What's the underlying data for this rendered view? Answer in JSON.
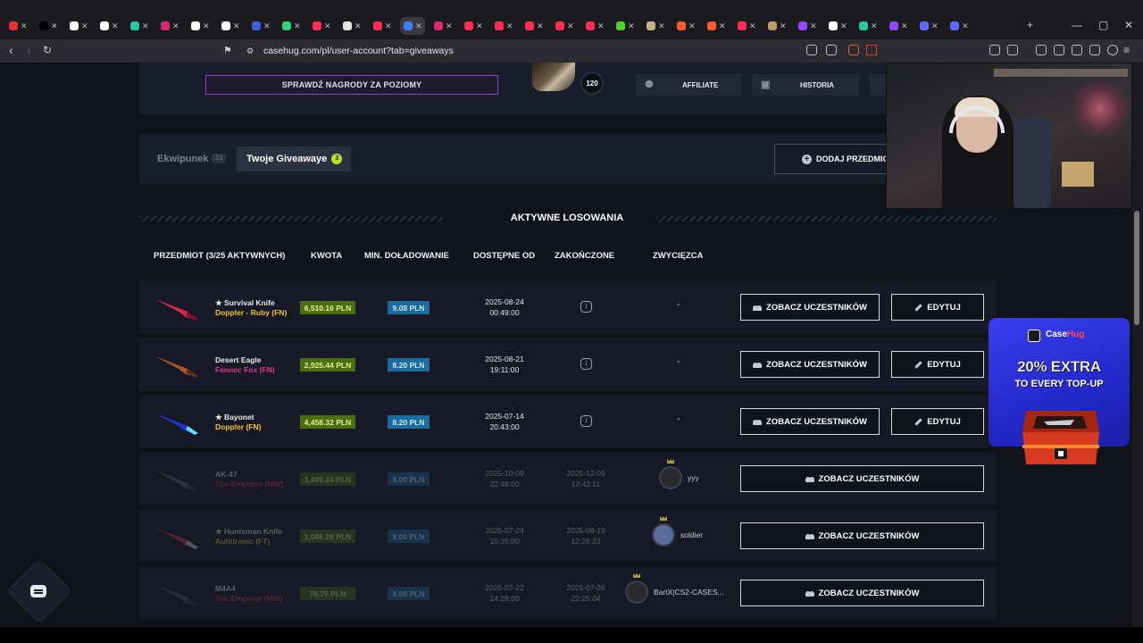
{
  "browser": {
    "url": "casehug.com/pl/user-account?tab=giveaways",
    "tab_favicon_colors": [
      "#e5323b",
      "#000000",
      "#ffffff",
      "#ffffff",
      "#27c7a0",
      "#d62976",
      "#ffffff",
      "#ffffff",
      "#3f5fd8",
      "#31d07a",
      "#ff2d55",
      "#e6e6e6",
      "#ff2d55",
      "#3f7cff",
      "#d62976",
      "#ff2d55",
      "#ff2d55",
      "#ff2d55",
      "#ff2d55",
      "#ff2d55",
      "#4cd32f",
      "#c9b48a",
      "#ff5a2d",
      "#ff5a2d",
      "#ff2d55",
      "#b89a6a",
      "#9146ff",
      "#ffffff",
      "#27c7a0",
      "#9146ff",
      "#5b6cff",
      "#5b6cff"
    ]
  },
  "header": {
    "levels_button": "SPRAWDŹ NAGRODY ZA POZIOMY",
    "level": "120",
    "affiliate": "AFFILIATE",
    "history": "HISTORIA"
  },
  "tabs": {
    "inventory": "Ekwipunek",
    "inventory_count": "23",
    "giveaways": "Twoje Giveawaye",
    "giveaways_count": "3",
    "add_item": "DODAJ PRZEDMIOT"
  },
  "section_title": "AKTYWNE LOSOWANIA",
  "table": {
    "columns": [
      "PRZEDMIOT (3/25 AKTYWNYCH)",
      "KWOTA",
      "MIN. DOŁADOWANIE",
      "DOSTĘPNE OD",
      "ZAKOŃCZONE",
      "ZWYCIĘZCA"
    ],
    "view_participants": "ZOBACZ UCZESTNIKÓW",
    "edit": "EDYTUJ",
    "rows": [
      {
        "name": "★ Survival Knife",
        "sub": "Doppler - Ruby (FN)",
        "sub_color": "#f2c230",
        "amount": "6,510.16 PLN",
        "min": "9.08 PLN",
        "date": "2025-08-24",
        "time": "00:49:00",
        "ended": "",
        "ended_time": "",
        "winner": "-",
        "active": true
      },
      {
        "name": "Desert Eagle",
        "sub": "Fennec Fox (FN)",
        "sub_color": "#d83a8c",
        "amount": "2,925.44 PLN",
        "min": "8.20 PLN",
        "date": "2025-08-21",
        "time": "19:11:00",
        "ended": "",
        "ended_time": "",
        "winner": "-",
        "active": true
      },
      {
        "name": "★ Bayonet",
        "sub": "Doppler (FN)",
        "sub_color": "#f2c230",
        "amount": "4,458.32 PLN",
        "min": "8.20 PLN",
        "date": "2025-07-14",
        "time": "20:43:00",
        "ended": "",
        "ended_time": "",
        "winner": "-",
        "active": true
      },
      {
        "name": "AK-47",
        "sub": "The Empress (MW)",
        "sub_color": "#d83a5c",
        "amount": "1,409.24 PLN",
        "min": "8.00 PLN",
        "date": "2025-10-09",
        "time": "22:48:00",
        "ended": "2025-12-09",
        "ended_time": "13:42:11",
        "winner": "yyy",
        "active": false
      },
      {
        "name": "★ Huntsman Knife",
        "sub": "Autotronic (FT)",
        "sub_color": "#f2c230",
        "amount": "1,086.28 PLN",
        "min": "8.00 PLN",
        "date": "2025-07-24",
        "time": "15:35:00",
        "ended": "2025-08-19",
        "ended_time": "12:26:23",
        "winner": "soldier",
        "active": false
      },
      {
        "name": "M4A4",
        "sub": "The Emperor (MW)",
        "sub_color": "#d83a5c",
        "amount": "76.76 PLN",
        "min": "8.00 PLN",
        "date": "2025-07-22",
        "time": "14:28:00",
        "ended": "2025-07-26",
        "ended_time": "22:25:04",
        "winner": "BartX|CS2-CASES...",
        "active": false
      }
    ]
  },
  "ad": {
    "brand_a": "Case",
    "brand_b": "Hug",
    "line1": "20% EXTRA",
    "line2": "TO EVERY TOP-UP"
  },
  "colors": {
    "accent_purple": "#8f3fd3",
    "price_green": "#4b6e11",
    "min_blue": "#1b6c9c",
    "page_bg": "#11131b"
  }
}
